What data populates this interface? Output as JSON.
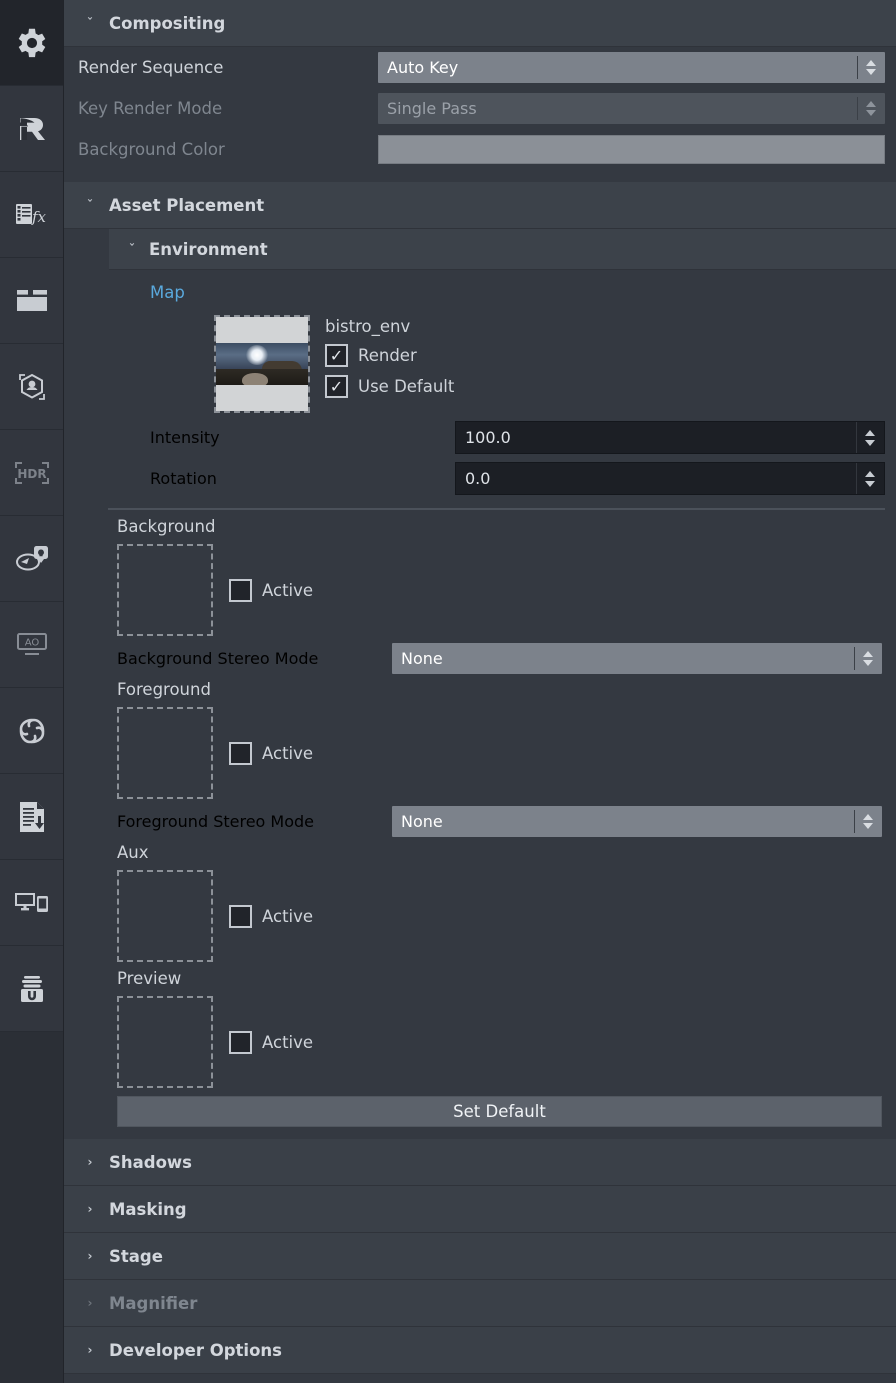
{
  "sidebar": {
    "items": [
      {
        "name": "settings-gear",
        "label": "Settings",
        "active": true
      },
      {
        "name": "render-r",
        "label": "Render"
      },
      {
        "name": "effects-fx",
        "label": "Effects"
      },
      {
        "name": "filmstrip",
        "label": "Media"
      },
      {
        "name": "capture-object",
        "label": "Capture"
      },
      {
        "name": "hdr",
        "label": "HDR"
      },
      {
        "name": "lighting",
        "label": "Lighting"
      },
      {
        "name": "ao",
        "label": "AO"
      },
      {
        "name": "swirl",
        "label": "Turntable"
      },
      {
        "name": "export-document",
        "label": "Export"
      },
      {
        "name": "devices",
        "label": "Devices"
      },
      {
        "name": "u-case",
        "label": "Library"
      }
    ]
  },
  "compositing": {
    "title": "Compositing",
    "caret": "ˇ",
    "rows": [
      {
        "label": "Render Sequence",
        "value": "Auto Key",
        "type": "combo",
        "disabled": false
      },
      {
        "label": "Key Render Mode",
        "value": "Single Pass",
        "type": "combo",
        "disabled": true
      },
      {
        "label": "Background Color",
        "value": "",
        "type": "color",
        "disabled": true,
        "color": "#8b9097"
      }
    ]
  },
  "asset_placement": {
    "title": "Asset Placement",
    "caret": "ˇ",
    "environment": {
      "title": "Environment",
      "caret": "ˇ",
      "map_link": "Map",
      "asset_name": "bistro_env",
      "checkboxes": [
        {
          "label": "Render",
          "checked": true,
          "mark": "✓"
        },
        {
          "label": "Use Default",
          "checked": true,
          "mark": "✓"
        }
      ],
      "fields": [
        {
          "label": "Intensity",
          "value": "100.0"
        },
        {
          "label": "Rotation",
          "value": "0.0"
        }
      ],
      "slots": [
        {
          "label": "Background",
          "active_label": "Active",
          "active": false,
          "stereo_label": "Background Stereo Mode",
          "stereo_value": "None"
        },
        {
          "label": "Foreground",
          "active_label": "Active",
          "active": false,
          "stereo_label": "Foreground Stereo Mode",
          "stereo_value": "None"
        },
        {
          "label": "Aux",
          "active_label": "Active",
          "active": false
        },
        {
          "label": "Preview",
          "active_label": "Active",
          "active": false
        }
      ],
      "set_default_label": "Set Default"
    }
  },
  "collapsed_sections": [
    {
      "label": "Shadows",
      "caret": "›",
      "disabled": false
    },
    {
      "label": "Masking",
      "caret": "›",
      "disabled": false
    },
    {
      "label": "Stage",
      "caret": "›",
      "disabled": false
    },
    {
      "label": "Magnifier",
      "caret": "›",
      "disabled": true
    },
    {
      "label": "Developer Options",
      "caret": "›",
      "disabled": false
    }
  ],
  "colors": {
    "panel_bg": "#343941",
    "header_bg": "#3c424a",
    "rail_bg": "#32363e",
    "accent_link": "#5aa9dd",
    "combo_bg": "#7c828b",
    "numfield_bg": "#1c1f25"
  }
}
